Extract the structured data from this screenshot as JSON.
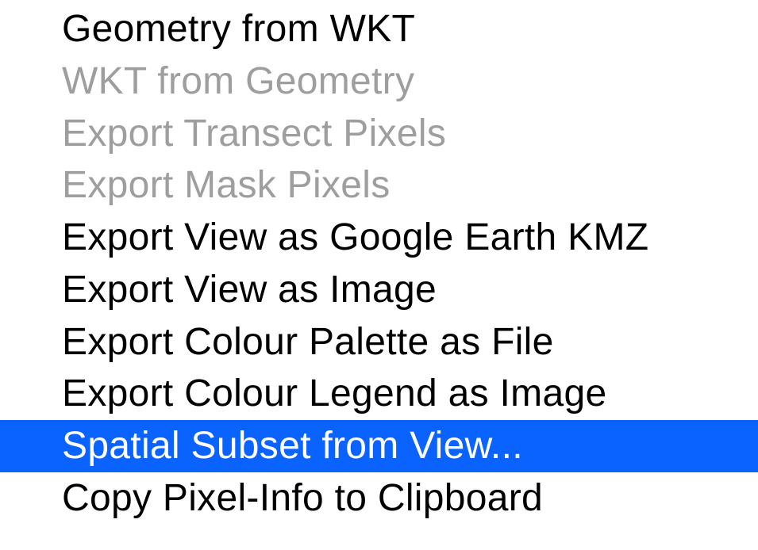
{
  "menu": {
    "items": [
      {
        "label": "Geometry from WKT",
        "state": "enabled"
      },
      {
        "label": "WKT from Geometry",
        "state": "disabled"
      },
      {
        "label": "Export Transect Pixels",
        "state": "disabled"
      },
      {
        "label": "Export Mask Pixels",
        "state": "disabled"
      },
      {
        "label": "Export View as Google Earth KMZ",
        "state": "enabled"
      },
      {
        "label": "Export View as Image",
        "state": "enabled"
      },
      {
        "label": "Export Colour Palette as File",
        "state": "enabled"
      },
      {
        "label": "Export Colour Legend as Image",
        "state": "enabled"
      },
      {
        "label": "Spatial Subset from View...",
        "state": "selected"
      },
      {
        "label": "Copy Pixel-Info to Clipboard",
        "state": "enabled"
      }
    ]
  }
}
